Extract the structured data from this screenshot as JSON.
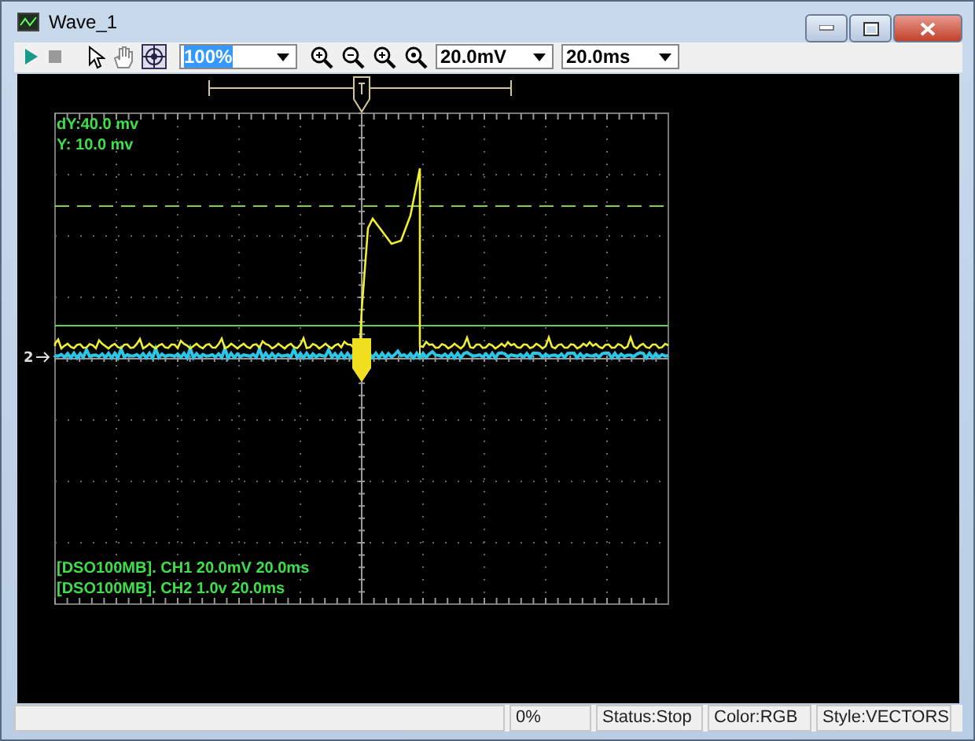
{
  "window": {
    "title": "Wave_1"
  },
  "toolbar": {
    "zoom": {
      "value": "100%"
    },
    "volts_per_div": {
      "value": "20.0mV"
    },
    "time_per_div": {
      "value": "20.0ms"
    }
  },
  "scope": {
    "cursor_readout": [
      "dY:40.0 mv",
      "Y:  10.0 mv"
    ],
    "channel_marker": "2",
    "channel_info": [
      "[DSO100MB]. CH1 20.0mV 20.0ms",
      "[DSO100MB]. CH2 1.0v 20.0ms"
    ]
  },
  "status_bar": [
    "0%",
    "Status:Stop",
    "Color:RGB",
    "Style:VECTORS"
  ]
}
